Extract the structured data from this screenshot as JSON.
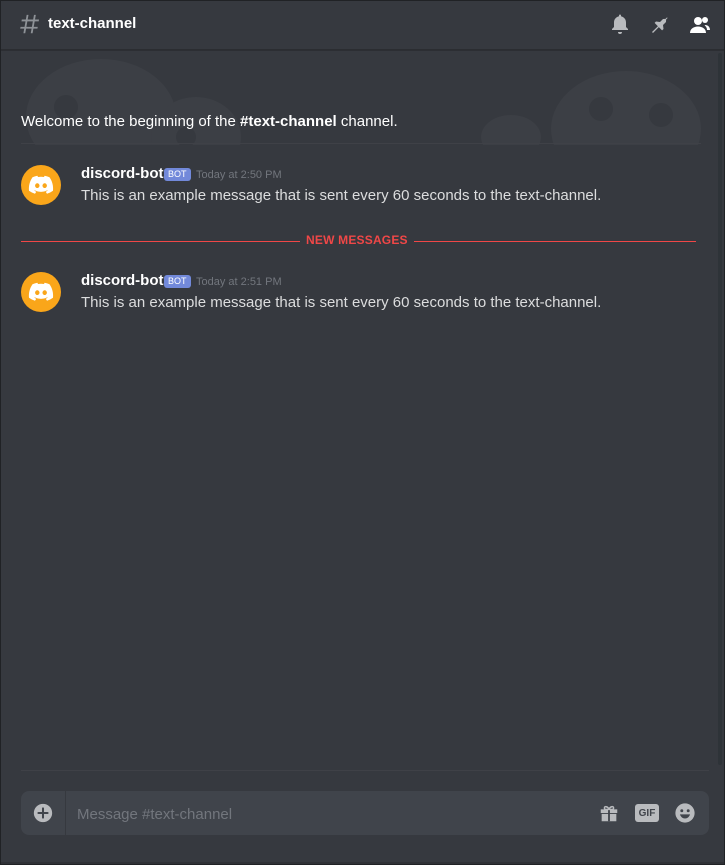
{
  "header": {
    "channel_name": "text-channel",
    "icons": [
      "hash-icon",
      "bell-icon",
      "pin-icon",
      "members-icon"
    ]
  },
  "welcome": {
    "prefix": "Welcome to the beginning of the ",
    "channel": "#text-channel",
    "suffix": " channel."
  },
  "messages": [
    {
      "author": "discord-bot",
      "tag": "BOT",
      "timestamp": "Today at 2:50 PM",
      "content": "This is an example message that is sent every 60 seconds to the text-channel."
    },
    {
      "author": "discord-bot",
      "tag": "BOT",
      "timestamp": "Today at 2:51 PM",
      "content": "This is an example message that is sent every 60 seconds to the text-channel."
    }
  ],
  "divider": {
    "label": "NEW MESSAGES"
  },
  "composer": {
    "placeholder": "Message #text-channel",
    "value": "",
    "gif_label": "GIF",
    "icons": [
      "add-attachment-icon",
      "gift-icon",
      "gif-icon",
      "emoji-icon"
    ]
  },
  "colors": {
    "background": "#36393f",
    "avatar": "#faa61a",
    "bot_tag": "#7289da",
    "new_messages": "#f04747"
  }
}
